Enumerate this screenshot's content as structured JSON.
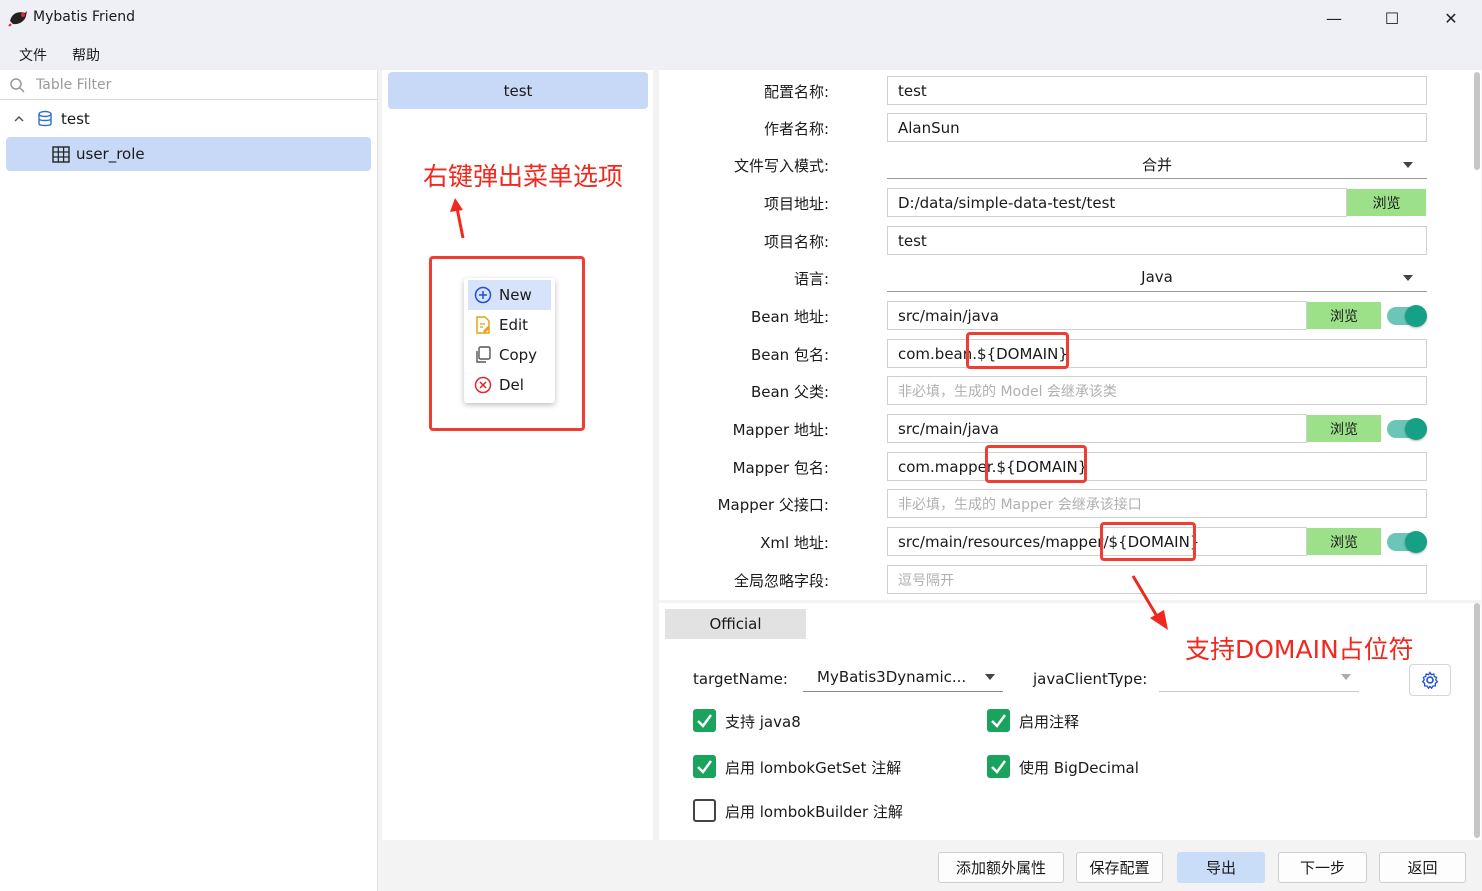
{
  "window": {
    "title": "Mybatis Friend",
    "minimize": "—",
    "maximize": "☐",
    "close": "✕"
  },
  "menu": [
    "文件",
    "帮助"
  ],
  "tree": {
    "filter_placeholder": "Table Filter",
    "database": "test",
    "tables": [
      "user_role"
    ]
  },
  "config_list": [
    "test"
  ],
  "annotations": {
    "context_menu_note": "右键弹出菜单选项",
    "domain_note": "支持DOMAIN占位符"
  },
  "context_menu": {
    "new": "New",
    "edit": "Edit",
    "copy": "Copy",
    "del": "Del"
  },
  "form": {
    "config_name_label": "配置名称:",
    "config_name": "test",
    "author_label": "作者名称:",
    "author": "AlanSun",
    "write_mode_label": "文件写入模式:",
    "write_mode": "合并",
    "project_path_label": "项目地址:",
    "project_path": "D:/data/simple-data-test/test",
    "project_name_label": "项目名称:",
    "project_name": "test",
    "language_label": "语言:",
    "language": "Java",
    "bean_path_label": "Bean 地址:",
    "bean_path": "src/main/java",
    "bean_package_label": "Bean 包名:",
    "bean_package": "com.bean.${DOMAIN}",
    "bean_parent_label": "Bean 父类:",
    "bean_parent_placeholder": "非必填，生成的 Model 会继承该类",
    "mapper_path_label": "Mapper 地址:",
    "mapper_path": "src/main/java",
    "mapper_package_label": "Mapper 包名:",
    "mapper_package": "com.mapper.${DOMAIN}",
    "mapper_parent_label": "Mapper 父接口:",
    "mapper_parent_placeholder": "非必填，生成的 Mapper 会继承该接口",
    "xml_path_label": "Xml 地址:",
    "xml_path": "src/main/resources/mapper/${DOMAIN}",
    "ignore_fields_label": "全局忽略字段:",
    "ignore_fields_placeholder": "逗号隔开",
    "browse": "浏览"
  },
  "official": {
    "tab": "Official",
    "target_name_label": "targetName:",
    "target_name": "MyBatis3Dynamic...",
    "java_client_type_label": "javaClientType:",
    "java_client_type": "",
    "checks": [
      {
        "label": "支持 java8",
        "checked": true
      },
      {
        "label": "启用注释",
        "checked": true
      },
      {
        "label": "启用 lombokGetSet 注解",
        "checked": true
      },
      {
        "label": "使用 BigDecimal",
        "checked": true
      },
      {
        "label": "启用 lombokBuilder 注解",
        "checked": false
      }
    ]
  },
  "footer": {
    "add_props": "添加额外属性",
    "save": "保存配置",
    "export": "导出",
    "next": "下一步",
    "back": "返回"
  },
  "colors": {
    "accent": "#c7d9f7",
    "browse_green": "#9de08a",
    "toggle_teal": "#16a085",
    "checkbox_green": "#19a35c",
    "annotation_red": "#f0281e"
  }
}
